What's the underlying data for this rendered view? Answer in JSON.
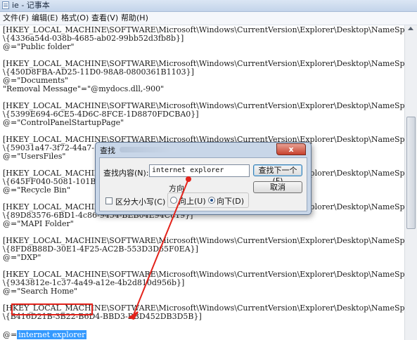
{
  "window": {
    "title": "ie - 记事本"
  },
  "menu": [
    "文件(F)",
    "编辑(E)",
    "格式(O)",
    "查看(V)",
    "帮助(H)"
  ],
  "editor": {
    "lines": [
      "[HKEY_LOCAL_MACHINE\\SOFTWARE\\Microsoft\\Windows\\CurrentVersion\\Explorer\\Desktop\\NameSpace",
      "\\{4336a54d-038b-4685-ab02-99bb52d3fb8b}]",
      "@=\"Public folder\"",
      "",
      "[HKEY_LOCAL_MACHINE\\SOFTWARE\\Microsoft\\Windows\\CurrentVersion\\Explorer\\Desktop\\NameSpace",
      "\\{450D8FBA-AD25-11D0-98A8-0800361B1103}]",
      "@=\"Documents\"",
      "\"Removal Message\"=\"@mydocs.dll,-900\"",
      "",
      "[HKEY_LOCAL_MACHINE\\SOFTWARE\\Microsoft\\Windows\\CurrentVersion\\Explorer\\Desktop\\NameSpace",
      "\\{5399E694-6CE5-4D6C-8FCE-1D8870FDCBA0}]",
      "@=\"ControlPanelStartupPage\"",
      "",
      "[HKEY_LOCAL_MACHINE\\SOFTWARE\\Microsoft\\Windows\\CurrentVersion\\Explorer\\Desktop\\NameSpace",
      "\\{59031a47-3f72-44a7-",
      "@=\"UsersFiles\"",
      "",
      "[HKEY_LOCAL_MACHINE\\SOFTWARE\\Microsoft\\Windows\\CurrentVersion\\Explorer\\Desktop\\NameSpace",
      "\\{645FF040-5081-101B-",
      "@=\"Recycle Bin\"",
      "",
      "[HKEY_LOCAL_MACHINE\\SOFTWARE\\Microsoft\\Windows\\CurrentVersion\\Explorer\\Desktop\\NameSpace",
      "\\{89D83576-6BD1-4c86-9454-BEB04E94C819}]",
      "@=\"MAPI Folder\"",
      "",
      "[HKEY_LOCAL_MACHINE\\SOFTWARE\\Microsoft\\Windows\\CurrentVersion\\Explorer\\Desktop\\NameSpace",
      "\\{8FD8B88D-30E1-4F25-AC2B-553D3D65F0EA}]",
      "@=\"DXP\"",
      "",
      "[HKEY_LOCAL_MACHINE\\SOFTWARE\\Microsoft\\Windows\\CurrentVersion\\Explorer\\Desktop\\NameSpace",
      "\\{9343812e-1c37-4a49-a12e-4b2d810d956b}]",
      "@=\"Search Home\"",
      "",
      "[HKEY_LOCAL_MACHINE\\SOFTWARE\\Microsoft\\Windows\\CurrentVersion\\Explorer\\Desktop\\NameSpace",
      "\\{B416D21B-3B22-B6D4-BBD3-BBD452DB3D5B}]"
    ],
    "last_line_prefix": "@=",
    "selected_text": "internet explorer"
  },
  "find_dialog": {
    "title": "查找",
    "close_label": "x",
    "find_label": "查找内容(N):",
    "find_value": "internet explorer",
    "find_next_label": "查找下一个(F)",
    "cancel_label": "取消",
    "direction_label": "方向",
    "up_label": "向上(U)",
    "down_label": "向下(D)",
    "direction_selected": "down",
    "match_case_label": "区分大小写(C)",
    "match_case_checked": false
  },
  "colors": {
    "selection": "#3399ff",
    "annotation": "#e3231b"
  }
}
